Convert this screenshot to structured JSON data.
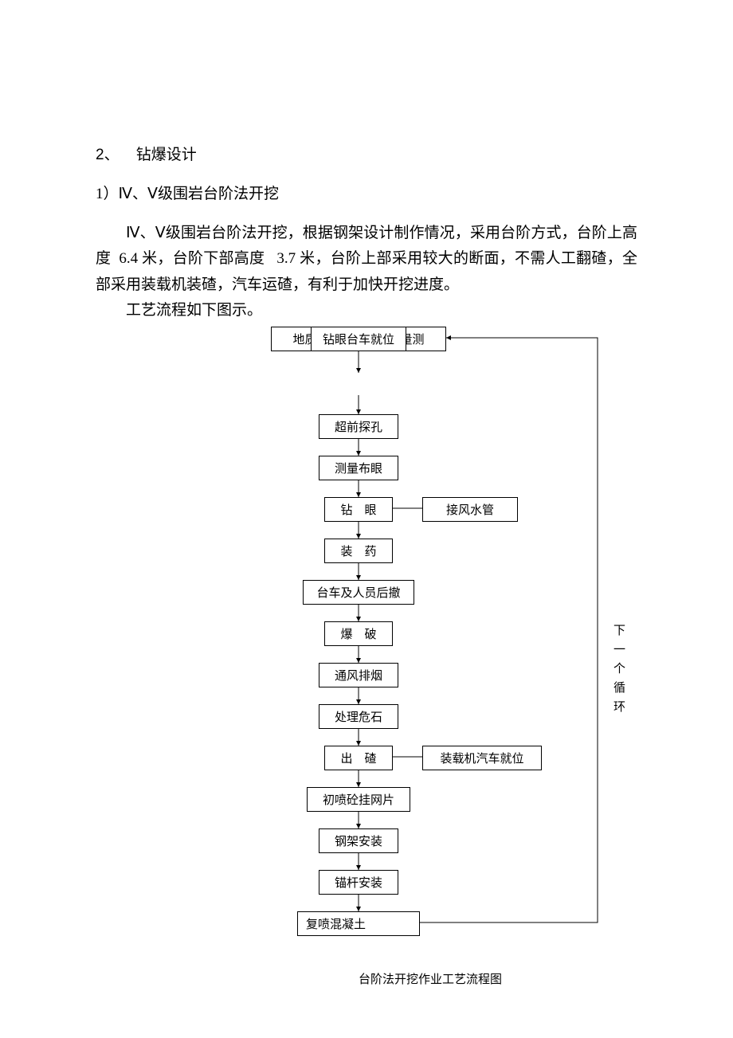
{
  "heading1_num": "2、",
  "heading1_title": "钻爆设计",
  "heading2": "1）Ⅳ、Ⅴ级围岩台阶法开挖",
  "para1a": "Ⅳ、Ⅴ级围岩台阶法开挖，根据钢架设计制作情况，采用台阶方式，台阶上高度",
  "para1b": "6.4 米，台阶下部高度",
  "para1c": "3.7 米，台阶上部采用较大的断面，不需人工翻碴，全部采用装载机装碴，汽车运碴，有利于加快开挖进度。",
  "para2": "工艺流程如下图示。",
  "boxes": {
    "b1": "地质超前预报、监控量测",
    "b2": "钻眼台车就位",
    "b3": "超前探孔",
    "b4": "测量布眼",
    "b5": "钻　眼",
    "b6": "装　药",
    "b7": "台车及人员后撤",
    "b8": "爆　破",
    "b9": "通风排烟",
    "b10": "处理危石",
    "b11": "出　碴",
    "b12": "初喷砼挂网片",
    "b13": "钢架安装",
    "b14": "锚杆安装",
    "b15": "复喷混凝土",
    "side1": "接风水管",
    "side2": "装载机汽车就位"
  },
  "side_label": "下一个循环",
  "caption": "台阶法开挖作业工艺流程图",
  "chart_data": {
    "type": "flowchart",
    "title": "台阶法开挖作业工艺流程图",
    "nodes": [
      {
        "id": "n1",
        "label": "地质超前预报、监控量测"
      },
      {
        "id": "n2",
        "label": "钻眼台车就位"
      },
      {
        "id": "n3",
        "label": "超前探孔"
      },
      {
        "id": "n4",
        "label": "测量布眼"
      },
      {
        "id": "n5",
        "label": "钻 眼"
      },
      {
        "id": "n6",
        "label": "装 药"
      },
      {
        "id": "n7",
        "label": "台车及人员后撤"
      },
      {
        "id": "n8",
        "label": "爆 破"
      },
      {
        "id": "n9",
        "label": "通风排烟"
      },
      {
        "id": "n10",
        "label": "处理危石"
      },
      {
        "id": "n11",
        "label": "出 碴"
      },
      {
        "id": "n12",
        "label": "初喷砼挂网片"
      },
      {
        "id": "n13",
        "label": "钢架安装"
      },
      {
        "id": "n14",
        "label": "锚杆安装"
      },
      {
        "id": "n15",
        "label": "复喷混凝土"
      },
      {
        "id": "s1",
        "label": "接风水管"
      },
      {
        "id": "s2",
        "label": "装载机汽车就位"
      }
    ],
    "edges": [
      [
        "n1",
        "n2"
      ],
      [
        "n2",
        "n3"
      ],
      [
        "n3",
        "n4"
      ],
      [
        "n4",
        "n5"
      ],
      [
        "n5",
        "n6"
      ],
      [
        "n6",
        "n7"
      ],
      [
        "n7",
        "n8"
      ],
      [
        "n8",
        "n9"
      ],
      [
        "n9",
        "n10"
      ],
      [
        "n10",
        "n11"
      ],
      [
        "n11",
        "n12"
      ],
      [
        "n12",
        "n13"
      ],
      [
        "n13",
        "n14"
      ],
      [
        "n14",
        "n15"
      ],
      [
        "s1",
        "n5"
      ],
      [
        "s2",
        "n11"
      ],
      [
        "n15",
        "n1"
      ]
    ],
    "loop_label": "下一个循环"
  }
}
